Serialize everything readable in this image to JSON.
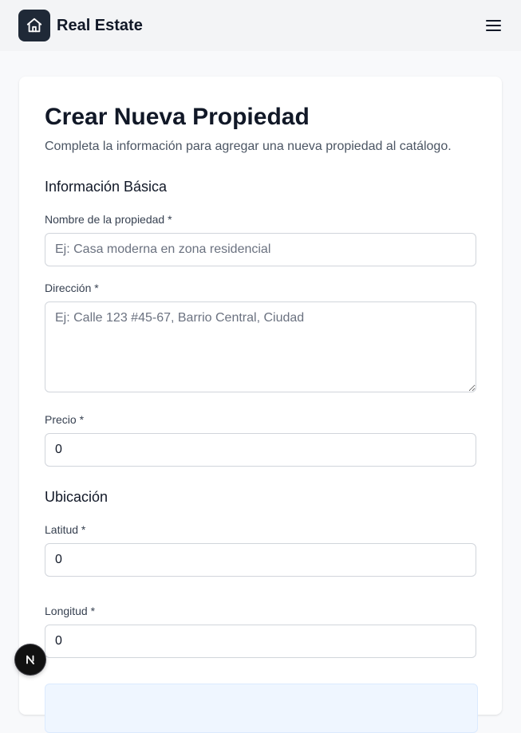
{
  "header": {
    "brand": "Real Estate",
    "logo_icon": "home-icon",
    "menu_icon": "hamburger-menu-icon"
  },
  "form": {
    "title": "Crear Nueva Propiedad",
    "subtitle": "Completa la información para agregar una nueva propiedad al catálogo.",
    "sections": {
      "basic": "Información Básica",
      "location": "Ubicación"
    },
    "fields": {
      "name": {
        "label": "Nombre de la propiedad *",
        "placeholder": "Ej: Casa moderna en zona residencial",
        "value": ""
      },
      "address": {
        "label": "Dirección *",
        "placeholder": "Ej: Calle 123 #45-67, Barrio Central, Ciudad",
        "value": ""
      },
      "price": {
        "label": "Precio *",
        "value": "0"
      },
      "latitude": {
        "label": "Latitud *",
        "value": "0"
      },
      "longitude": {
        "label": "Longitud *",
        "value": "0"
      }
    }
  },
  "dev_badge": {
    "letter": "N"
  },
  "colors": {
    "logo_bg": "#1f2937",
    "header_bg": "#f3f4f6",
    "page_bg": "#f8f9fb",
    "info_bg": "#eff6ff"
  }
}
